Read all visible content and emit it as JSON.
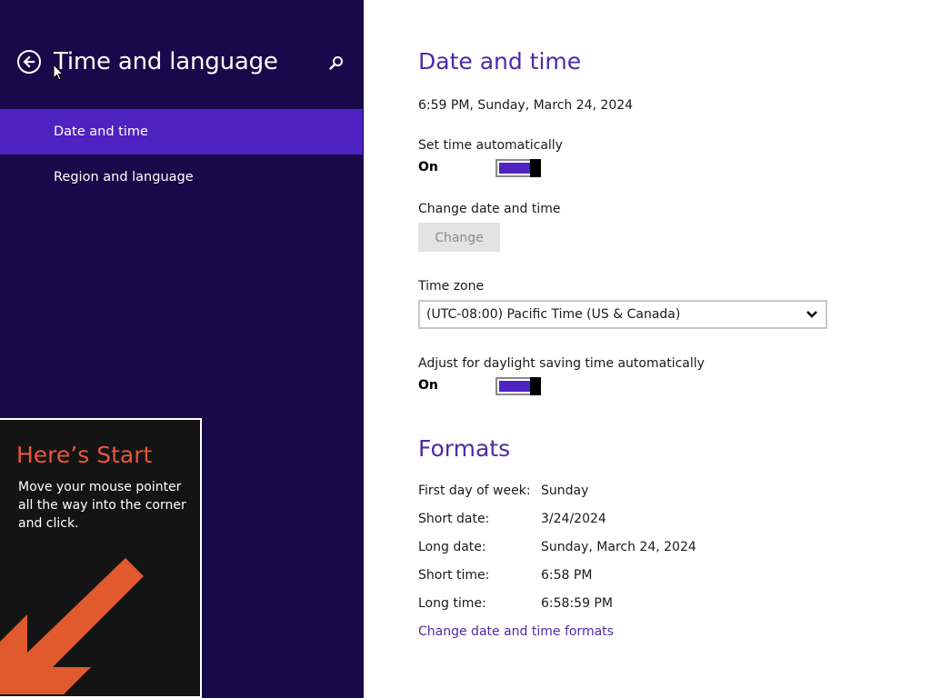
{
  "left_pane": {
    "title": "Time and language",
    "back_icon": "back-arrow-circle-icon",
    "search_icon": "search-icon",
    "nav": [
      {
        "label": "Date and time",
        "selected": true
      },
      {
        "label": "Region and language",
        "selected": false
      }
    ],
    "background_color": "#180a4a",
    "selected_color": "#4f22c2"
  },
  "start_tip": {
    "title": "Here’s Start",
    "body": "Move your mouse pointer all the way into the corner and click.",
    "arrow_icon": "arrow-down-left-icon",
    "title_color": "#e8573a",
    "arrow_color": "#e05a2e"
  },
  "date_time": {
    "heading": "Date and time",
    "current": "6:59 PM, Sunday, March 24, 2024",
    "set_auto_label": "Set time automatically",
    "set_auto_state": "On",
    "change_label": "Change date and time",
    "change_button": "Change",
    "timezone_label": "Time zone",
    "timezone_value": "(UTC-08:00) Pacific Time (US & Canada)",
    "dst_label": "Adjust for daylight saving time automatically",
    "dst_state": "On",
    "accent_color": "#4d2aa8"
  },
  "formats": {
    "heading": "Formats",
    "rows": [
      {
        "label": "First day of week:",
        "value": "Sunday"
      },
      {
        "label": "Short date:",
        "value": "3/24/2024"
      },
      {
        "label": "Long date:",
        "value": "Sunday, March 24, 2024"
      },
      {
        "label": "Short time:",
        "value": "6:58 PM"
      },
      {
        "label": "Long time:",
        "value": "6:58:59 PM"
      }
    ],
    "link": "Change date and time formats"
  }
}
